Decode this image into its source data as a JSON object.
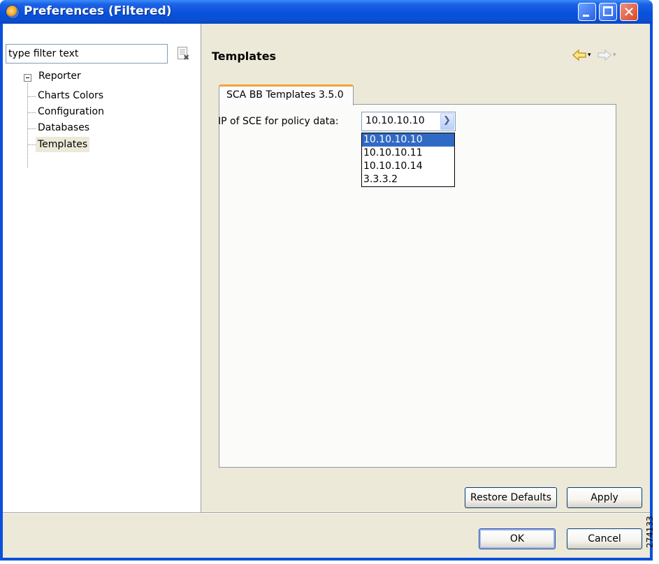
{
  "window": {
    "title": "Preferences (Filtered)",
    "controls": {
      "minimize": "minimize",
      "maximize": "maximize",
      "close": "✕"
    }
  },
  "filter": {
    "value": "type filter text",
    "clear_icon": "clear-filter-icon"
  },
  "tree": {
    "root_label": "Reporter",
    "root_toggle": "⊟",
    "items": [
      {
        "label": "Charts Colors",
        "selected": false
      },
      {
        "label": "Configuration",
        "selected": false
      },
      {
        "label": "Databases",
        "selected": false
      },
      {
        "label": "Templates",
        "selected": true
      }
    ]
  },
  "page": {
    "title": "Templates",
    "nav": {
      "back_icon": "back-arrow-icon",
      "forward_icon": "forward-arrow-icon",
      "dropdown": "▾"
    }
  },
  "tab": {
    "label": "SCA BB Templates 3.5.0",
    "accent_color": "#f3a339"
  },
  "field": {
    "label": "IP of SCE for policy data:",
    "selected_value": "10.10.10.10",
    "options": [
      {
        "label": "10.10.10.10",
        "highlighted": true
      },
      {
        "label": "10.10.10.11",
        "highlighted": false
      },
      {
        "label": "10.10.10.14",
        "highlighted": false
      },
      {
        "label": "3.3.3.2",
        "highlighted": false
      }
    ]
  },
  "buttons": {
    "restore_defaults": "Restore Defaults",
    "apply": "Apply",
    "ok": "OK",
    "cancel": "Cancel"
  },
  "figure_id": "274133",
  "colors": {
    "titlebar": "#0852dc",
    "selection": "#316ac5",
    "dialog_bg": "#ece9d8"
  }
}
